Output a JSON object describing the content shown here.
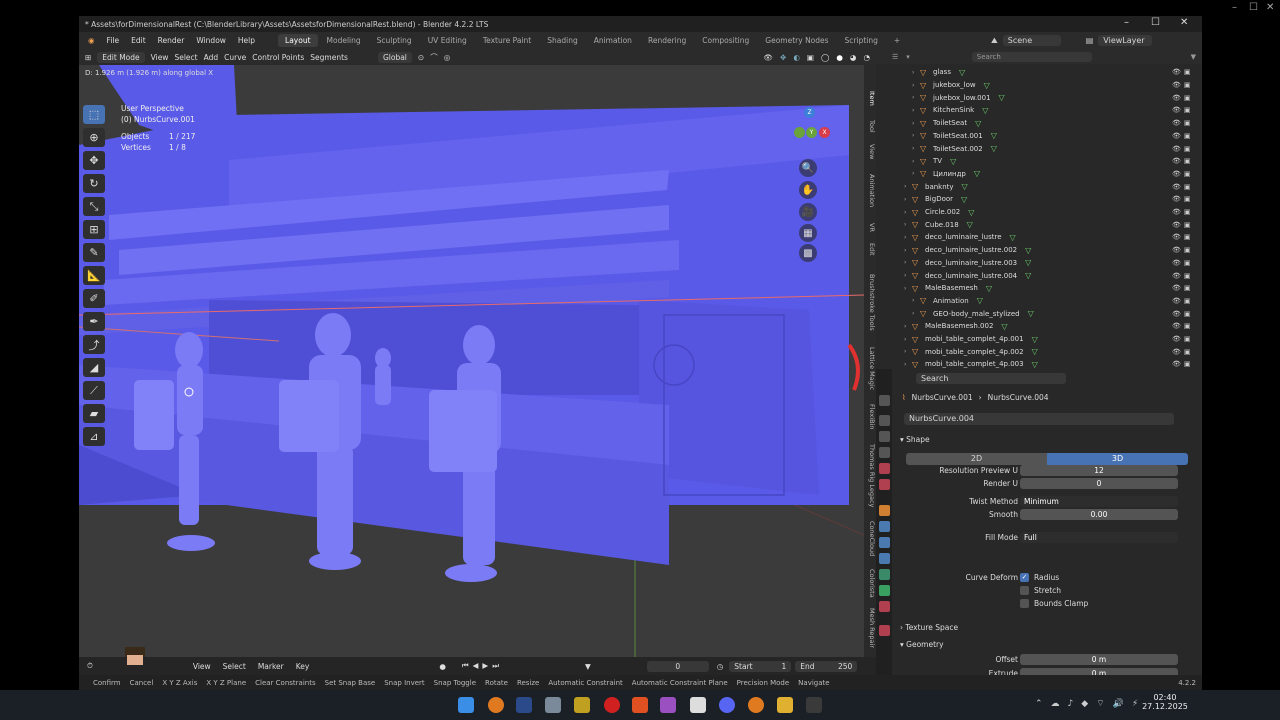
{
  "window": {
    "title": "* Assets\\forDimensionalRest (C:\\BlenderLibrary\\Assets\\AssetsforDimensionalRest.blend) - Blender 4.2.2 LTS"
  },
  "menu": [
    "File",
    "Edit",
    "Render",
    "Window",
    "Help"
  ],
  "workspaces": [
    "Layout",
    "Modeling",
    "Sculpting",
    "UV Editing",
    "Texture Paint",
    "Shading",
    "Animation",
    "Rendering",
    "Compositing",
    "Geometry Nodes",
    "Scripting"
  ],
  "active_workspace": "Layout",
  "scene": {
    "label": "Scene",
    "view_layer": "ViewLayer"
  },
  "viewport_header": {
    "mode": "Edit Mode",
    "menus": [
      "View",
      "Select",
      "Add",
      "Curve",
      "Control Points",
      "Segments"
    ],
    "orientation": "Global"
  },
  "status_message": "D: 1.926 m (1.926 m) along global X",
  "viewport_info": {
    "perspective": "User Perspective",
    "object": "(0) NurbsCurve.001",
    "objects_label": "Objects",
    "objects_value": "1 / 217",
    "vertices_label": "Vertices",
    "vertices_value": "1 / 8"
  },
  "gizmo": {
    "x": "X",
    "y": "Y",
    "z": "Z"
  },
  "side_tabs": [
    "Item",
    "Tool",
    "View",
    "Animation",
    "VR",
    "Edit",
    "Brushstroke Tools",
    "Lattice Magic",
    "FlexiBin",
    "Thomas Rig Legacy",
    "ConeCloud",
    "Colorista",
    "Mesh Repair"
  ],
  "timeline": {
    "menus": [
      "View",
      "Select",
      "Marker",
      "Key"
    ],
    "current_frame": "0",
    "start_label": "Start",
    "start": "1",
    "end_label": "End",
    "end": "250"
  },
  "statusbar": [
    "Confirm",
    "Cancel",
    "X Y Z Axis",
    "X Y Z Plane",
    "Clear Constraints",
    "Set Snap Base",
    "Snap Invert",
    "Snap Toggle",
    "Rotate",
    "Resize",
    "Automatic Constraint",
    "Automatic Constraint Plane",
    "Precision Mode",
    "Navigate"
  ],
  "version": "4.2.2",
  "outliner": {
    "search_placeholder": "Search",
    "rows": [
      {
        "name": "glass",
        "depth": 2
      },
      {
        "name": "jukebox_low",
        "depth": 2
      },
      {
        "name": "jukebox_low.001",
        "depth": 2
      },
      {
        "name": "KitchenSink",
        "depth": 2
      },
      {
        "name": "ToiletSeat",
        "depth": 2
      },
      {
        "name": "ToiletSeat.001",
        "depth": 2
      },
      {
        "name": "ToiletSeat.002",
        "depth": 2
      },
      {
        "name": "TV",
        "depth": 2
      },
      {
        "name": "Цилиндр",
        "depth": 2
      },
      {
        "name": "banknty",
        "depth": 1
      },
      {
        "name": "BigDoor",
        "depth": 1
      },
      {
        "name": "Circle.002",
        "depth": 1
      },
      {
        "name": "Cube.018",
        "depth": 1
      },
      {
        "name": "deco_luminaire_lustre",
        "depth": 1
      },
      {
        "name": "deco_luminaire_lustre.002",
        "depth": 1
      },
      {
        "name": "deco_luminaire_lustre.003",
        "depth": 1
      },
      {
        "name": "deco_luminaire_lustre.004",
        "depth": 1
      },
      {
        "name": "MaleBasemesh",
        "depth": 1
      },
      {
        "name": "Animation",
        "depth": 2
      },
      {
        "name": "GEO-body_male_stylized",
        "depth": 2
      },
      {
        "name": "MaleBasemesh.002",
        "depth": 1
      },
      {
        "name": "mobi_table_complet_4p.001",
        "depth": 1
      },
      {
        "name": "mobi_table_complet_4p.002",
        "depth": 1
      },
      {
        "name": "mobi_table_complet_4p.003",
        "depth": 1
      }
    ]
  },
  "properties": {
    "search_placeholder": "Search",
    "breadcrumb_object": "NurbsCurve.001",
    "breadcrumb_data": "NurbsCurve.004",
    "datablock": "NurbsCurve.004",
    "shape_panel": "Shape",
    "dim_2d": "2D",
    "dim_3d": "3D",
    "fields": [
      {
        "label": "Resolution Preview U",
        "value": "12"
      },
      {
        "label": "Render U",
        "value": "0"
      },
      {
        "label": "Twist Method",
        "value": "Minimum"
      },
      {
        "label": "Smooth",
        "value": "0.00"
      },
      {
        "label": "Fill Mode",
        "value": "Full"
      }
    ],
    "curve_deform_label": "Curve Deform",
    "checkboxes": [
      {
        "label": "Radius",
        "checked": true
      },
      {
        "label": "Stretch",
        "checked": false
      },
      {
        "label": "Bounds Clamp",
        "checked": false
      }
    ],
    "texture_space_panel": "Texture Space",
    "geometry_panel": "Geometry",
    "geometry_fields": [
      {
        "label": "Offset",
        "value": "0 m"
      },
      {
        "label": "Extrude",
        "value": "0 m"
      }
    ]
  },
  "taskbar": {
    "time": "02:40",
    "date": "27.12.2025"
  }
}
